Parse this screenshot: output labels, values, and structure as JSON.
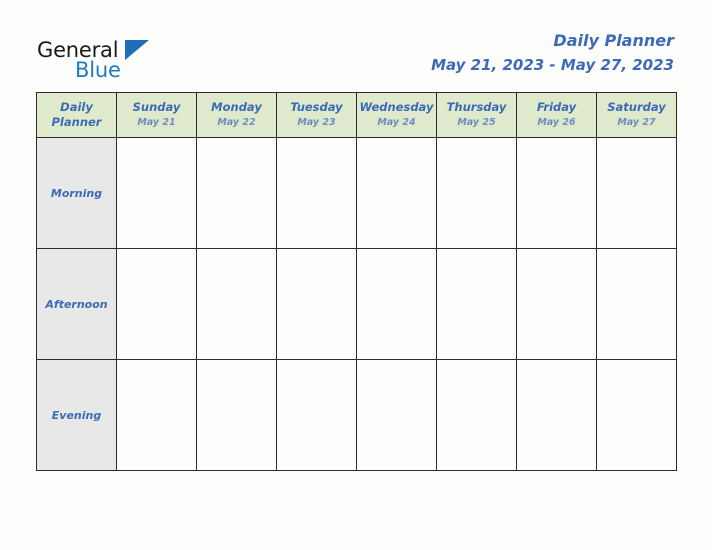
{
  "brand": {
    "name_part1": "General",
    "name_part2": "Blue",
    "triangle_color": "#1f6fb8",
    "text_color_primary": "#1a1a1a",
    "text_color_secondary": "#1f7cc4"
  },
  "header": {
    "title": "Daily Planner",
    "date_range": "May 21, 2023 - May 27, 2023",
    "title_color": "#3b6bb5"
  },
  "table": {
    "corner_label_line1": "Daily",
    "corner_label_line2": "Planner",
    "header_bg": "#dfeacd",
    "period_bg": "#e8e8e8",
    "slot_bg": "#fdfdfd",
    "border_color": "#2b2b2b",
    "days": [
      {
        "name": "Sunday",
        "date": "May 21"
      },
      {
        "name": "Monday",
        "date": "May 22"
      },
      {
        "name": "Tuesday",
        "date": "May 23"
      },
      {
        "name": "Wednesday",
        "date": "May 24"
      },
      {
        "name": "Thursday",
        "date": "May 25"
      },
      {
        "name": "Friday",
        "date": "May 26"
      },
      {
        "name": "Saturday",
        "date": "May 27"
      }
    ],
    "periods": [
      {
        "label": "Morning",
        "entries": [
          "",
          "",
          "",
          "",
          "",
          "",
          ""
        ]
      },
      {
        "label": "Afternoon",
        "entries": [
          "",
          "",
          "",
          "",
          "",
          "",
          ""
        ]
      },
      {
        "label": "Evening",
        "entries": [
          "",
          "",
          "",
          "",
          "",
          "",
          ""
        ]
      }
    ]
  }
}
